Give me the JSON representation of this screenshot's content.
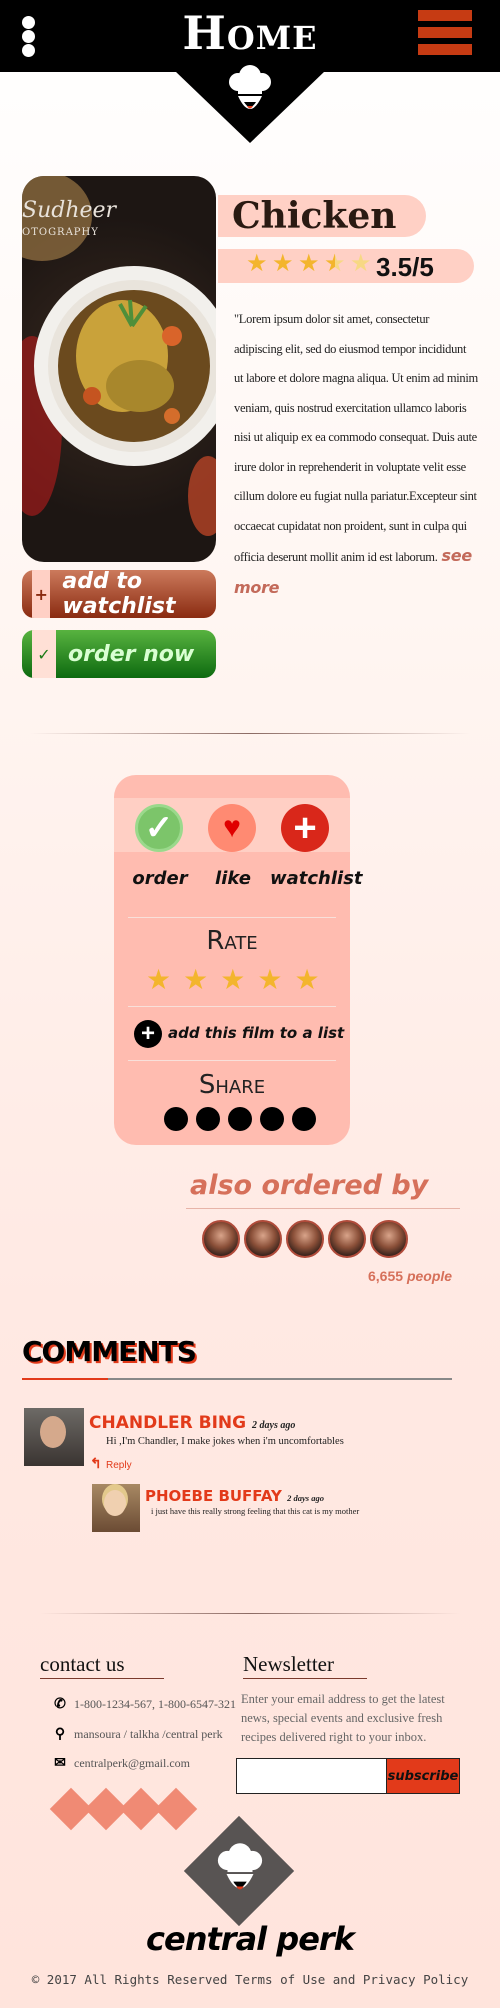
{
  "header": {
    "title": "Home",
    "menu_icon": "kebab-menu-icon",
    "hamburger_icon": "hamburger-menu-icon",
    "logo_icon": "chef-hat-icon",
    "bg_color": "#000000",
    "accent_color": "#c63b13"
  },
  "hero": {
    "watermark_name": "Sudheer",
    "watermark_sub": "OTOGRAPHY",
    "title": "Chicken",
    "rating": 3.5,
    "rating_text": "3.5/5",
    "stars": [
      "full",
      "full",
      "full",
      "half",
      "empty"
    ],
    "description": "\"Lorem ipsum dolor sit amet, consectetur adipiscing elit, sed do eiusmod tempor incididunt ut labore et dolore magna aliqua. Ut enim ad minim veniam, quis nostrud exercitation ullamco laboris nisi ut aliquip ex ea commodo consequat. Duis aute irure dolor in reprehenderit in voluptate velit esse cillum dolore eu fugiat nulla pariatur.Excepteur sint occaecat cupidatat non proident, sunt in culpa qui officia deserunt mollit anim id est laborum.",
    "see_more": "see more",
    "watchlist_label": "add to watchlist",
    "watchlist_icon": "+",
    "order_label": "order now",
    "order_icon": "✓"
  },
  "actions": {
    "order_label": "order",
    "like_label": "like",
    "watchlist_label": "watchlist",
    "rate_title": "Rate",
    "rate_stars": 5,
    "add_list_label": "add this film to a list",
    "share_title": "Share",
    "share_count": 5
  },
  "also_ordered": {
    "title": "also ordered by",
    "count": "6,655",
    "people_label": "people",
    "avatar_count": 5
  },
  "comments": {
    "title": "COMMENTS",
    "items": [
      {
        "name": "CHANDLER BING",
        "time": "2 days ago",
        "text": "Hi ,I'm Chandler, I make jokes when i'm uncomfortables",
        "reply": "Reply"
      },
      {
        "name": "PHOEBE BUFFAY",
        "time": "2 days ago",
        "text": "i just have this really strong feeling that this cat is my mother"
      }
    ]
  },
  "footer": {
    "contact_title": "contact us",
    "phone": "1-800-1234-567, 1-800-6547-321",
    "address": "mansoura / talkha /central perk",
    "email": "centralperk@gmail.com",
    "newsletter_title": "Newsletter",
    "newsletter_text": "Enter your email address to get the latest news, special events and exclusive fresh recipes delivered right to your inbox.",
    "subscribe_label": "subscribe",
    "brand": "central perk",
    "copyright": "© 2017 All Rights Reserved Terms of Use and Privacy Policy"
  }
}
